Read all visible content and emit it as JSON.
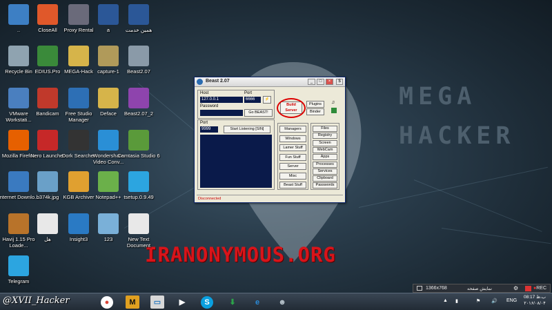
{
  "wallpaper": {
    "mega_text": "MEGA HACKER",
    "watermark": "IRANONYMOUS.ORG"
  },
  "desktop_icons": [
    {
      "label": "..",
      "icon": "computer-icon",
      "color": "#3d7fc4"
    },
    {
      "label": "CloseAll",
      "icon": "close-x-icon",
      "color": "#e0582a"
    },
    {
      "label": "Proxy Rental",
      "icon": "proxy-icon",
      "color": "#6a6a7a"
    },
    {
      "label": "a",
      "icon": "word-doc-icon",
      "color": "#2b5797"
    },
    {
      "label": "همین خدمت",
      "icon": "word-doc-icon",
      "color": "#2b5797"
    },
    {
      "label": "Recycle Bin",
      "icon": "recycle-bin-icon",
      "color": "#8fa3b0"
    },
    {
      "label": "EDIUS.Pro",
      "icon": "edius-icon",
      "color": "#3a8a3a"
    },
    {
      "label": "MEGA-Hack",
      "icon": "folder-icon",
      "color": "#d6b44a"
    },
    {
      "label": "capture-1",
      "icon": "film-icon",
      "color": "#b09a5a"
    },
    {
      "label": "Beast2.07",
      "icon": "alien-icon",
      "color": "#8a9aa8"
    },
    {
      "label": "VMware Workstati...",
      "icon": "vmware-icon",
      "color": "#4a7fbf"
    },
    {
      "label": "Bandicam",
      "icon": "bandicam-icon",
      "color": "#c0392b"
    },
    {
      "label": "Free Studio Manager",
      "icon": "free-studio-icon",
      "color": "#2d6fb5"
    },
    {
      "label": "Deface",
      "icon": "folder-icon",
      "color": "#d6b44a"
    },
    {
      "label": "Beast2.07_2",
      "icon": "winrar-icon",
      "color": "#8e44ad"
    },
    {
      "label": "Mozilla Firefox",
      "icon": "firefox-icon",
      "color": "#e66000"
    },
    {
      "label": "Nero Launcher",
      "icon": "nero-icon",
      "color": "#c62828"
    },
    {
      "label": "Dork Searcher",
      "icon": "dork-searcher-icon",
      "color": "#333333"
    },
    {
      "label": "Wondershare Video Conv...",
      "icon": "wondershare-icon",
      "color": "#2a8fd6"
    },
    {
      "label": "Camtasia Studio 6",
      "icon": "camtasia-icon",
      "color": "#5a9a3a"
    },
    {
      "label": "Internet Downlo...",
      "icon": "idm-icon",
      "color": "#3a7ac0"
    },
    {
      "label": "b374k.jpg",
      "icon": "image-file-icon",
      "color": "#6aa0c8"
    },
    {
      "label": "KGB Archiver",
      "icon": "kgb-archiver-icon",
      "color": "#e0a030"
    },
    {
      "label": "Notepad++",
      "icon": "notepad-plus-icon",
      "color": "#6bb04a"
    },
    {
      "label": "tsetup.0.9.49",
      "icon": "telegram-icon",
      "color": "#2ca5e0"
    },
    {
      "label": "Havij 1.15 Pro Loade...",
      "icon": "havij-icon",
      "color": "#b8732a"
    },
    {
      "label": "هل",
      "icon": "text-file-icon",
      "color": "#e8e8e8"
    },
    {
      "label": "Insight3",
      "icon": "insight-icon",
      "color": "#2a7ac4"
    },
    {
      "label": "123",
      "icon": "notes-icon",
      "color": "#7ab0d8"
    },
    {
      "label": "New Text Document",
      "icon": "text-file-icon",
      "color": "#e8e8e8"
    },
    {
      "label": "Telegram",
      "icon": "telegram-icon",
      "color": "#2ca5e0"
    }
  ],
  "beast": {
    "title": "Beast 2.07",
    "host_label": "Host",
    "host_value": "127.0.0.1",
    "port_label": "Port",
    "port_value": "6666",
    "password_label": "Password",
    "go_beast": "Go BEAST!",
    "build_server": "Build Server",
    "plugins": "Plugins",
    "binder": "Binder",
    "listen_port_label": "Port",
    "listen_port_value": "9999",
    "start_listening": "Start Listening [SIN]",
    "left_buttons": [
      "Managers",
      "Windows",
      "Lamer Stuff",
      "Fun Stuff",
      "Server",
      "Misc",
      "Beast Stuff"
    ],
    "right_buttons": [
      "Files",
      "Registry",
      "Screen",
      "WebCam",
      "Apps",
      "Processes",
      "Services",
      "Clipboard",
      "Passwords"
    ],
    "status": "Disconnected"
  },
  "notify": {
    "resolution": "1366x768",
    "tray_label": "نمایش صفحه",
    "rec": "REC"
  },
  "taskbar": {
    "signature": "@XVII_Hacker",
    "lang": "ENG",
    "time": "08:17 ب.ظ",
    "date": "۲۰۱۶/۰۸/۰۴"
  }
}
